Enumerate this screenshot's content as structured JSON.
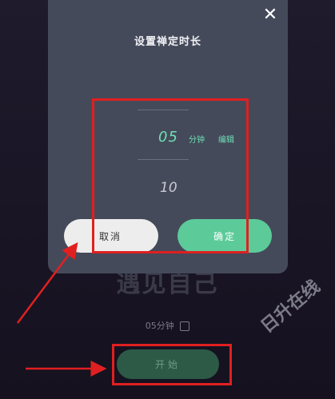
{
  "background": {
    "title": "遇见自己",
    "duration_label": "05分钟",
    "start_button": "开始"
  },
  "dialog": {
    "title": "设置禅定时长",
    "close_glyph": "✕",
    "picker": {
      "selected_value": "05",
      "unit": "分钟",
      "edit_label": "编辑",
      "next_value": "10"
    },
    "cancel_button": "取消",
    "confirm_button": "确定"
  },
  "annotations": {
    "highlight_color": "#e02020"
  },
  "watermark": "日升在线",
  "colors": {
    "accent_green": "#5ccb99",
    "picker_green": "#6fe0b6",
    "dialog_bg": "#454a5a",
    "page_bg": "#1b1628"
  }
}
